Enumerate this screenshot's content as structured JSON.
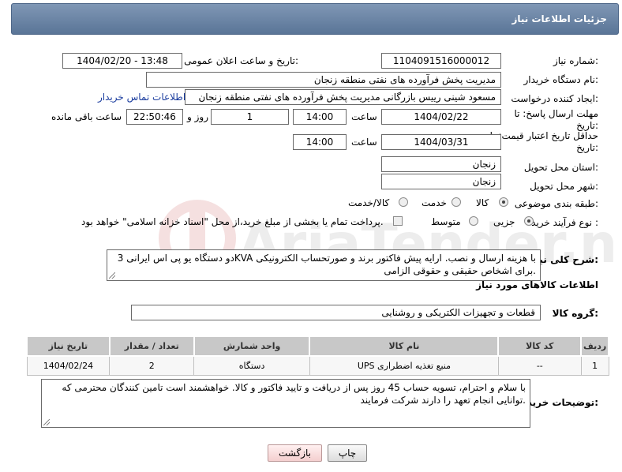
{
  "header": {
    "title": "جزئیات اطلاعات نیاز"
  },
  "labels": {
    "need_number": "شماره نیاز:",
    "announce_datetime": "تاریخ و ساعت اعلان عمومی:",
    "buyer_org": "نام دستگاه خریدار:",
    "requester": "ایجاد کننده درخواست:",
    "reply_deadline": "مهلت ارسال پاسخ: تا تاریخ:",
    "time": "ساعت",
    "day_and": "روز و",
    "remaining": "ساعت باقی مانده",
    "price_validity": "حداقل تاریخ اعتبار قیمت: تا تاریخ:",
    "delivery_province": "استان محل تحویل:",
    "delivery_city": "شهر محل تحویل:",
    "subject_category": "طبقه بندی موضوعی:",
    "process_type": "نوع فرآیند خرید :",
    "description": "شرح کلی نیاز:",
    "goods_info": "اطلاعات کالاهای مورد نیاز",
    "goods_group": "گروه کالا:",
    "buyer_notes": "توضیحات خریدار:"
  },
  "fields": {
    "need_number": "1104091516000012",
    "announce_datetime": "1404/02/20 - 13:48",
    "buyer_org": "مدیریت پخش فرآورده های نفتی منطقه زنجان",
    "requester": "مسعود شینی رییس بازرگانی مدیریت پخش فرآورده های نفتی منطقه زنجان",
    "contact_link": "اطلاعات تماس خریدار",
    "reply_date": "1404/02/22",
    "reply_time": "14:00",
    "reply_days": "1",
    "reply_remaining": "22:50:46",
    "validity_date": "1404/03/31",
    "validity_time": "14:00",
    "province": "زنجان",
    "city": "زنجان",
    "goods_group": "قطعات و تجهیزات الکتریکی و روشنایی"
  },
  "category_options": [
    {
      "label": "کالا",
      "selected": true
    },
    {
      "label": "خدمت",
      "selected": false
    },
    {
      "label": "کالا/خدمت",
      "selected": false
    }
  ],
  "process_options": [
    {
      "label": "جزیی",
      "selected": true
    },
    {
      "label": "متوسط",
      "selected": false
    }
  ],
  "payment_note": "پرداخت تمام یا بخشی از مبلغ خرید،از محل \"اسناد خزانه اسلامی\" خواهد بود.",
  "description_text": "دو دستگاه یو پی اس ایرانی 3KVA با هزینه ارسال و نصب. ارایه پیش فاکتور برند و صورتحساب الکترونیکی برای اشخاص حقیقی و حقوقی الزامی.",
  "table": {
    "headers": [
      "ردیف",
      "کد کالا",
      "نام کالا",
      "واحد شمارش",
      "تعداد / مقدار",
      "تاریخ نیاز"
    ],
    "rows": [
      [
        "1",
        "--",
        "منبع تغذیه اضطراری UPS",
        "دستگاه",
        "2",
        "1404/02/24"
      ]
    ]
  },
  "buyer_notes_text": "با سلام و احترام، تسویه حساب 45 روز پس از دریافت و تایید فاکتور و کالا. خواهشمند است تامین کنندگان محترمی که توانایی انجام تعهد را دارند شرکت فرمایند.",
  "buttons": {
    "print": "چاپ",
    "back": "بازگشت"
  },
  "watermark": {
    "text": "AriaTender.neT"
  }
}
